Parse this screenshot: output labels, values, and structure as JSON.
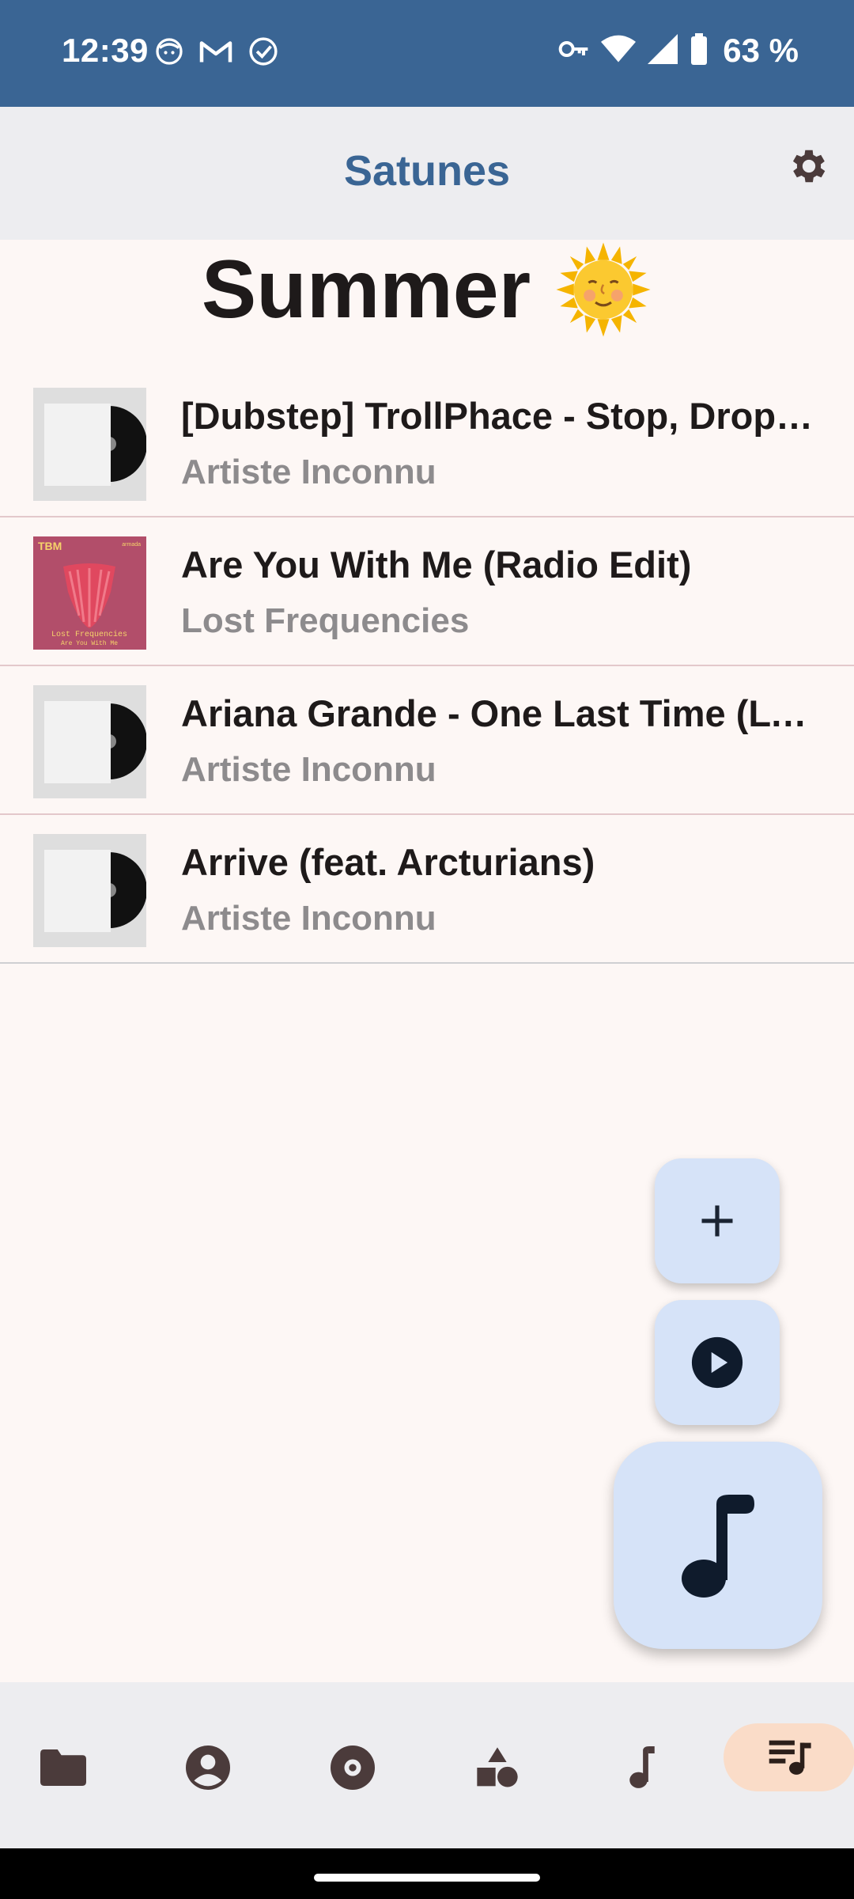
{
  "status_bar": {
    "time": "12:39",
    "battery": "63 %",
    "left_icons": [
      "face-icon",
      "gmail-icon",
      "check-circle-icon"
    ],
    "right_icons": [
      "vpn-key-icon",
      "wifi-icon",
      "signal-icon",
      "battery-icon"
    ]
  },
  "app_bar": {
    "title": "Satunes",
    "settings_icon": "gear-icon"
  },
  "playlist": {
    "name": "Summer",
    "emoji": "sun-with-face"
  },
  "songs": [
    {
      "title": "[Dubstep] TrollPhace - Stop, Drop & Roll",
      "artist": "Artiste Inconnu",
      "cover": "vinyl-placeholder"
    },
    {
      "title": "Are You With Me (Radio Edit)",
      "artist": "Lost Frequencies",
      "cover": "album-art",
      "cover_text": {
        "label": "TBM",
        "top_right": "armada",
        "line1": "Lost Frequencies",
        "line2": "Are You With Me"
      }
    },
    {
      "title": "Ariana Grande - One Last Time (Lyrics)",
      "artist": "Artiste Inconnu",
      "cover": "vinyl-placeholder"
    },
    {
      "title": "Arrive (feat. Arcturians)",
      "artist": "Artiste Inconnu",
      "cover": "vinyl-placeholder"
    }
  ],
  "fabs": {
    "add_icon": "plus-icon",
    "play_icon": "play-circle-icon",
    "now_playing_icon": "music-note-icon"
  },
  "bottom_nav": {
    "items": [
      "folder-icon",
      "account-icon",
      "album-icon",
      "genre-shapes-icon",
      "music-note-icon",
      "playlist-icon"
    ],
    "active": "playlist-icon"
  },
  "colors": {
    "status_bar": "#3a6594",
    "accent": "#3a6594",
    "fab": "#d6e3f8",
    "nav_active": "#fadcc8",
    "divider": "#e3c8cb"
  }
}
